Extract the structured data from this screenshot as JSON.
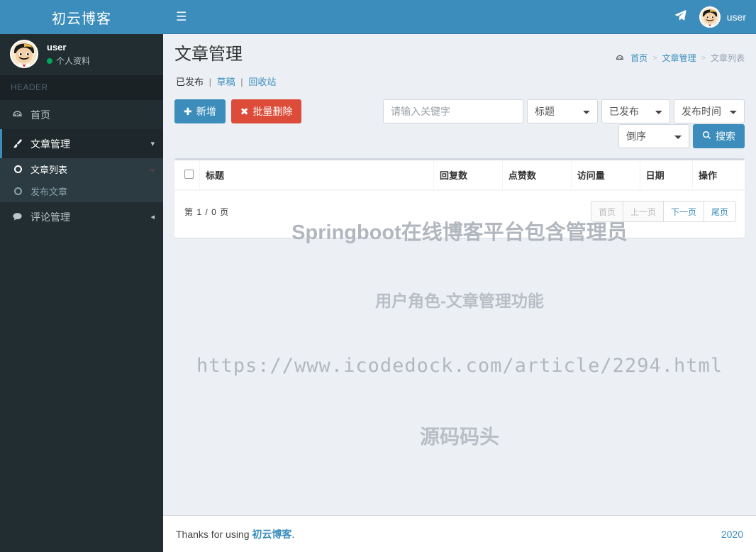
{
  "sidebar": {
    "logo": "初云博客",
    "user": {
      "name": "user",
      "status": "个人资料"
    },
    "header_label": "HEADER",
    "items": [
      {
        "label": "首页",
        "icon": "dashboard-icon"
      },
      {
        "label": "文章管理",
        "icon": "brush-icon",
        "caret": "chevron-down-icon"
      },
      {
        "label": "评论管理",
        "icon": "comment-icon",
        "caret": "chevron-left-icon"
      }
    ],
    "subitems": [
      {
        "label": "文章列表",
        "icon": "circle-icon"
      },
      {
        "label": "发布文章",
        "icon": "circle-o-icon"
      }
    ]
  },
  "topbar": {
    "menu_icon": "hamburger-icon",
    "plane_icon": "paper-plane-icon",
    "user_label": "user"
  },
  "page": {
    "title": "文章管理",
    "breadcrumb": [
      {
        "label": "首页",
        "link": true
      },
      {
        "label": "文章管理",
        "link": true
      },
      {
        "label": "文章列表",
        "link": false
      }
    ],
    "breadcrumb_sep": ">",
    "subtabs": {
      "published": "已发布",
      "draft": "草稿",
      "recycle": "回收站",
      "divider": "|"
    }
  },
  "toolbar": {
    "add_label": "新增",
    "add_icon": "plus-icon",
    "delete_label": "批量删除",
    "delete_icon": "times-icon",
    "search_label": "搜索",
    "search_icon": "search-icon"
  },
  "filters": {
    "keyword_placeholder": "请输入关键字",
    "keyword_value": "",
    "field_selected": "标题",
    "status_selected": "已发布",
    "time_selected": "发布时间",
    "order_selected": "倒序"
  },
  "table": {
    "columns": [
      "",
      "标题",
      "回复数",
      "点赞数",
      "访问量",
      "日期",
      "操作"
    ],
    "rows": []
  },
  "pagination": {
    "info_prefix": "第",
    "current": "1",
    "slash": "/",
    "total": "0",
    "info_suffix": "页",
    "first": "首页",
    "prev": "上一页",
    "next": "下一页",
    "last": "尾页"
  },
  "watermarks": {
    "line1": "Springboot在线博客平台包含管理员",
    "line2": "用户角色-文章管理功能",
    "line3": "https://www.icodedock.com/article/2294.html",
    "line4": "源码码头"
  },
  "footer": {
    "thanks": "Thanks for using",
    "brand": "初云博客",
    "period": ".",
    "year": "2020"
  },
  "colors": {
    "brand_blue": "#3c8dbc",
    "sidebar_dark": "#222d32",
    "danger_red": "#dd4b39",
    "content_bg": "#ecf0f5",
    "status_green": "#00a65a"
  }
}
